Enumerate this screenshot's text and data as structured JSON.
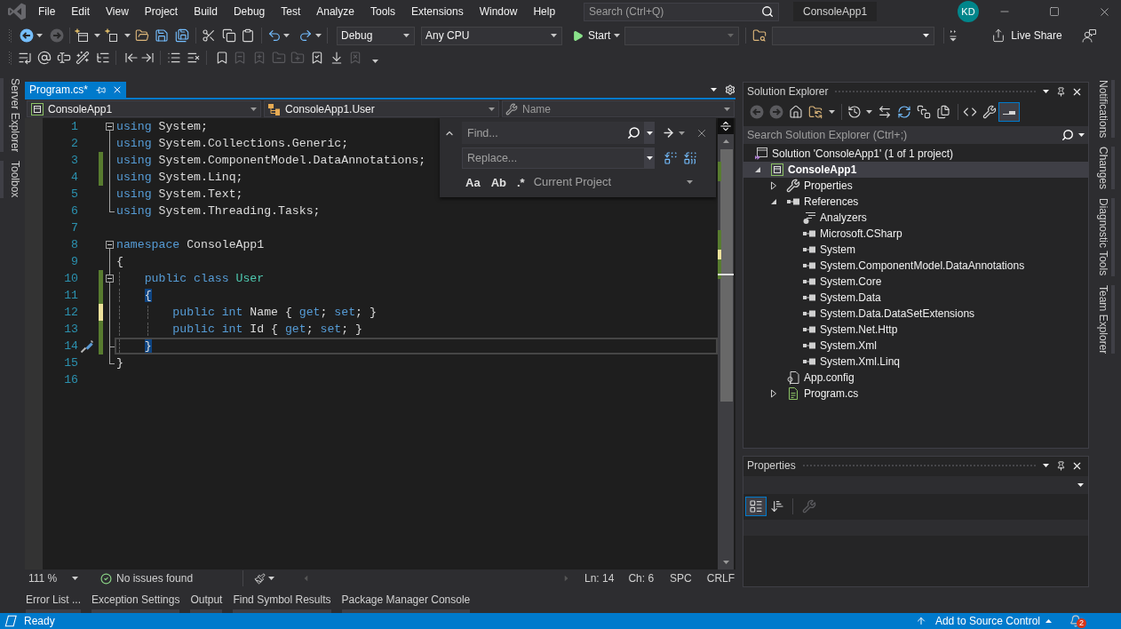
{
  "title_bar": {
    "menu": [
      "File",
      "Edit",
      "View",
      "Project",
      "Build",
      "Debug",
      "Test",
      "Analyze",
      "Tools",
      "Extensions",
      "Window",
      "Help"
    ],
    "search": {
      "placeholder": "Search (Ctrl+Q)"
    },
    "solution_name": "ConsoleApp1",
    "avatar_initials": "KD"
  },
  "standard_toolbar": {
    "buttons": [
      {
        "disabled": false
      },
      {
        "disabled": true
      },
      {
        "disabled": false
      },
      {
        "disabled": false
      },
      {
        "disabled": false
      },
      {
        "disabled": false
      },
      {
        "disabled": false
      },
      {
        "disabled": false
      },
      {
        "disabled": false
      },
      {
        "disabled": false
      },
      {
        "disabled": false
      },
      {
        "disabled": false
      }
    ],
    "configuration": "Debug",
    "platform": "Any CPU",
    "start_label": "Start",
    "live_share_label": "Live Share"
  },
  "text_editor_toolbar": {
    "buttons": [
      {
        "disabled": false
      },
      {
        "disabled": false
      },
      {
        "disabled": false
      },
      {
        "disabled": false
      },
      {
        "disabled": false
      },
      {
        "disabled": false
      },
      {
        "disabled": false
      },
      {
        "disabled": false
      },
      {
        "disabled": false
      },
      {
        "disabled": false
      },
      {
        "disabled": true
      },
      {
        "disabled": true
      },
      {
        "disabled": true
      },
      {
        "disabled": true
      },
      {
        "disabled": false
      },
      {
        "disabled": false
      },
      {
        "disabled": true
      }
    ]
  },
  "left_dock_tabs": [
    "Server Explorer",
    "Toolbox"
  ],
  "editor": {
    "tabs": [
      {
        "label": "Program.cs*",
        "selected": true
      }
    ],
    "navigation_bar": {
      "project": "ConsoleApp1",
      "type": "ConsoleApp1.User",
      "member": "Name"
    },
    "find_widget": {
      "find_placeholder": "Find...",
      "replace_placeholder": "Replace...",
      "options": [
        {
          "label": "Aa",
          "selected": false
        },
        {
          "label": "Ab",
          "selected": false
        },
        {
          "label": ".*",
          "selected": false
        }
      ],
      "scope": "Current Project"
    },
    "lines": [
      {
        "number": "1",
        "tokens": [
          {
            "kind": "keyword",
            "text": "using"
          },
          {
            "kind": "plain",
            "text": " System;"
          }
        ],
        "current": false,
        "quick_action": false,
        "expanded": true,
        "children": [
          {
            "number": "2",
            "tokens": [
              {
                "kind": "keyword",
                "text": "using"
              },
              {
                "kind": "plain",
                "text": " System.Collections.Generic;"
              }
            ],
            "current": false,
            "quick_action": false
          },
          {
            "number": "3",
            "kind": "saved",
            "tokens": [
              {
                "kind": "keyword",
                "text": "using"
              },
              {
                "kind": "plain",
                "text": " System.ComponentModel.DataAnnotations;"
              }
            ],
            "current": false,
            "quick_action": false
          },
          {
            "number": "4",
            "kind": "saved",
            "tokens": [
              {
                "kind": "keyword",
                "text": "using"
              },
              {
                "kind": "plain",
                "text": " System.Linq;"
              }
            ],
            "current": false,
            "quick_action": false
          },
          {
            "number": "5",
            "tokens": [
              {
                "kind": "keyword",
                "text": "using"
              },
              {
                "kind": "plain",
                "text": " System.Text;"
              }
            ],
            "current": false,
            "quick_action": false
          },
          {
            "number": "6",
            "tokens": [
              {
                "kind": "keyword",
                "text": "using"
              },
              {
                "kind": "plain",
                "text": " System.Threading.Tasks;"
              }
            ],
            "current": false,
            "quick_action": false
          }
        ]
      },
      {
        "number": "7",
        "current": false,
        "quick_action": false
      },
      {
        "number": "8",
        "tokens": [
          {
            "kind": "keyword",
            "text": "namespace"
          },
          {
            "kind": "plain",
            "text": " ConsoleApp1"
          }
        ],
        "current": false,
        "quick_action": false,
        "expanded": true,
        "children": [
          {
            "number": "9",
            "tokens": [
              {
                "kind": "plain",
                "text": "{"
              }
            ],
            "current": false,
            "quick_action": false
          },
          {
            "number": "10",
            "kind": "saved",
            "tokens": [
              {
                "kind": "keyword",
                "text": "    public class"
              },
              {
                "kind": "type",
                "text": " User"
              }
            ],
            "current": false,
            "quick_action": false,
            "expanded": true,
            "children": [
              {
                "number": "11",
                "kind": "saved",
                "tokens": [
                  {
                    "kind": "brace_match",
                    "text": "    {"
                  }
                ],
                "current": false,
                "quick_action": false
              },
              {
                "number": "12",
                "kind": "unsaved",
                "tokens": [
                  {
                    "kind": "keyword",
                    "text": "        public int"
                  },
                  {
                    "kind": "plain",
                    "text": " Name { "
                  },
                  {
                    "kind": "keyword",
                    "text": "get"
                  },
                  {
                    "kind": "plain",
                    "text": "; "
                  },
                  {
                    "kind": "keyword",
                    "text": "set"
                  },
                  {
                    "kind": "plain",
                    "text": "; }"
                  }
                ],
                "current": false,
                "quick_action": false
              },
              {
                "number": "13",
                "kind": "saved",
                "tokens": [
                  {
                    "kind": "keyword",
                    "text": "        public int"
                  },
                  {
                    "kind": "plain",
                    "text": " Id { "
                  },
                  {
                    "kind": "keyword",
                    "text": "get"
                  },
                  {
                    "kind": "plain",
                    "text": "; "
                  },
                  {
                    "kind": "keyword",
                    "text": "set"
                  },
                  {
                    "kind": "plain",
                    "text": "; }"
                  }
                ],
                "current": false,
                "quick_action": false
              },
              {
                "number": "14",
                "kind": "saved",
                "tokens": [
                  {
                    "kind": "brace_match",
                    "text": "    }"
                  }
                ],
                "current": true,
                "quick_action": true
              }
            ]
          },
          {
            "number": "15",
            "tokens": [
              {
                "kind": "plain",
                "text": "}"
              }
            ],
            "current": false,
            "quick_action": false
          }
        ]
      },
      {
        "number": "16",
        "current": false,
        "quick_action": false
      }
    ],
    "status": {
      "zoom": "111 %",
      "issues": "No issues found",
      "line": "Ln: 14",
      "column": "Ch: 6",
      "indentation": "SPC",
      "line_endings": "CRLF"
    }
  },
  "solution_explorer": {
    "title": "Solution Explorer",
    "toolbar": [
      {
        "disabled": true,
        "selected": false
      },
      {
        "disabled": true,
        "selected": false
      },
      {
        "disabled": false,
        "selected": false
      },
      {
        "disabled": false,
        "selected": false
      },
      {
        "disabled": false,
        "selected": false
      },
      {
        "disabled": false,
        "selected": false
      },
      {
        "disabled": false,
        "selected": false
      },
      {
        "disabled": false,
        "selected": false
      },
      {
        "disabled": false,
        "selected": false
      },
      {
        "disabled": false,
        "selected": false
      },
      {
        "disabled": false,
        "selected": false
      },
      {
        "disabled": false,
        "selected": true
      }
    ],
    "search": {
      "placeholder": "Search Solution Explorer (Ctrl+;)"
    },
    "tree": [
      {
        "kind": "solution",
        "label": "Solution 'ConsoleApp1' (1 of 1 project)",
        "selected": false,
        "startup": false,
        "children": [
          {
            "kind": "project",
            "label": "ConsoleApp1",
            "expanded": true,
            "selected": true,
            "startup": true,
            "children": [
              {
                "kind": "properties",
                "label": "Properties",
                "expanded": false,
                "selected": false,
                "startup": false
              },
              {
                "kind": "references",
                "label": "References",
                "expanded": true,
                "selected": false,
                "startup": false,
                "children": [
                  {
                    "kind": "analyzers",
                    "label": "Analyzers",
                    "selected": false,
                    "startup": false
                  },
                  {
                    "kind": "reference",
                    "label": "Microsoft.CSharp",
                    "selected": false,
                    "startup": false
                  },
                  {
                    "kind": "reference",
                    "label": "System",
                    "selected": false,
                    "startup": false
                  },
                  {
                    "kind": "reference",
                    "label": "System.ComponentModel.DataAnnotations",
                    "selected": false,
                    "startup": false
                  },
                  {
                    "kind": "reference",
                    "label": "System.Core",
                    "selected": false,
                    "startup": false
                  },
                  {
                    "kind": "reference",
                    "label": "System.Data",
                    "selected": false,
                    "startup": false
                  },
                  {
                    "kind": "reference",
                    "label": "System.Data.DataSetExtensions",
                    "selected": false,
                    "startup": false
                  },
                  {
                    "kind": "reference",
                    "label": "System.Net.Http",
                    "selected": false,
                    "startup": false
                  },
                  {
                    "kind": "reference",
                    "label": "System.Xml",
                    "selected": false,
                    "startup": false
                  },
                  {
                    "kind": "reference",
                    "label": "System.Xml.Linq",
                    "selected": false,
                    "startup": false
                  }
                ]
              },
              {
                "kind": "config",
                "label": "App.config",
                "selected": false,
                "startup": false
              },
              {
                "kind": "code_file",
                "label": "Program.cs",
                "expanded": false,
                "selected": false,
                "startup": false
              }
            ]
          }
        ]
      }
    ]
  },
  "properties": {
    "title": "Properties",
    "toolbar": [
      {
        "selected": true,
        "disabled": false
      },
      {
        "selected": false,
        "disabled": false
      },
      {
        "selected": false,
        "disabled": true
      }
    ]
  },
  "right_dock_tabs": [
    "Notifications",
    "Changes",
    "Diagnostic Tools",
    "Team Explorer"
  ],
  "bottom_dock_tabs": [
    "Error List ...",
    "Exception Settings",
    "Output",
    "Find Symbol Results",
    "Package Manager Console"
  ],
  "status_bar": {
    "message": "Ready",
    "source_control": "Add to Source Control",
    "notification_count": "2"
  }
}
